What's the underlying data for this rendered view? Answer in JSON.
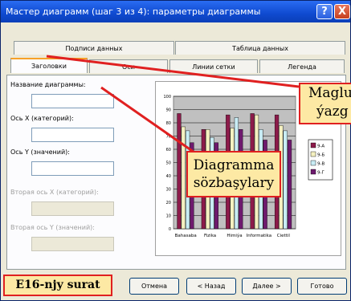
{
  "dialog": {
    "title": "Мастер диаграмм (шаг 3 из 4): параметры диаграммы",
    "help_label": "?",
    "close_label": "X"
  },
  "tabs": {
    "row1": [
      "Подписи данных",
      "Таблица данных"
    ],
    "row2": [
      "Заголовки",
      "Оси",
      "Линии сетки",
      "Легенда"
    ]
  },
  "fields": {
    "chart_title_label": "Название диаграммы:",
    "x_axis_label": "Ось X (категорий):",
    "y_axis_label": "Ось Y (значений):",
    "x2_axis_label": "Вторая ось X (категорий):",
    "y2_axis_label": "Вторая ось Y (значений):"
  },
  "buttons": {
    "cancel": "Отмена",
    "back": "< Назад",
    "next": "Далее >",
    "finish": "Готово"
  },
  "callouts": {
    "headings": "Diagramma sözbaşylary",
    "data_labels_line1": "Maglu",
    "data_labels_line2": "ýazg"
  },
  "figure_label": "E16-njy surat",
  "colors": {
    "series": [
      "#8c1b4a",
      "#f4f0c0",
      "#c8ecf4",
      "#6e1a6e"
    ],
    "callout_border": "#e02020",
    "callout_fill": "#fde9a4"
  },
  "chart_data": {
    "type": "bar",
    "categories": [
      "Bahasaba",
      "Fizika",
      "Himiýa",
      "Informatika",
      "Ciettil"
    ],
    "series": [
      {
        "name": "9-A",
        "values": [
          87,
          75,
          86,
          87,
          86
        ]
      },
      {
        "name": "9-Б",
        "values": [
          77,
          75,
          76,
          86,
          78
        ]
      },
      {
        "name": "9-В",
        "values": [
          74,
          69,
          84,
          75,
          74
        ]
      },
      {
        "name": "9-Г",
        "values": [
          65,
          65,
          75,
          67,
          67
        ]
      }
    ],
    "ylim": [
      0,
      100
    ],
    "yticks": [
      "0",
      "10",
      "20",
      "30",
      "40",
      "50",
      "60",
      "70",
      "80",
      "90",
      "100"
    ],
    "grid": true,
    "legend": "right"
  }
}
